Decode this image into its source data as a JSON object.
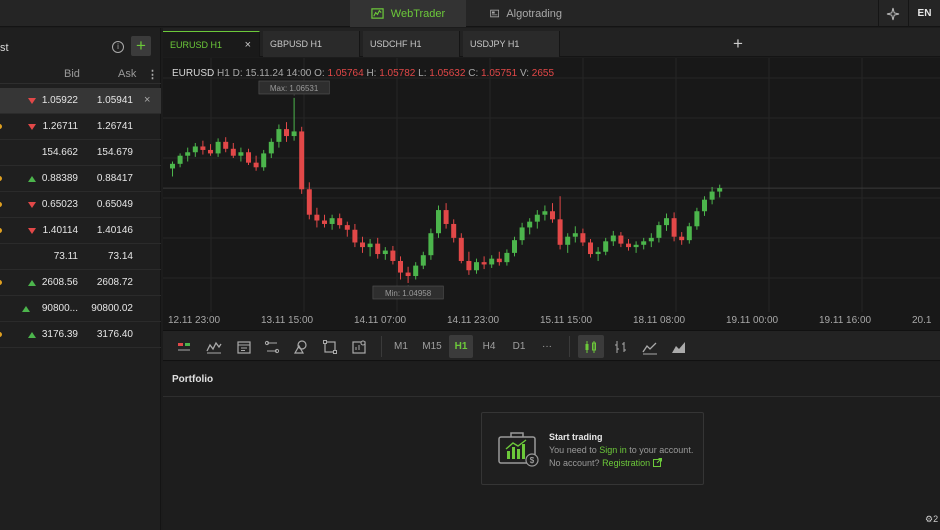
{
  "topbar": {
    "webtrader_label": "WebTrader",
    "algotrading_label": "Algotrading",
    "language": "EN",
    "accent": "#6cc93a"
  },
  "watchlist": {
    "title": "st",
    "bid_header": "Bid",
    "ask_header": "Ask",
    "rows": [
      {
        "bid": "1.05922",
        "ask": "1.05941",
        "dir": "down",
        "selected": true,
        "marker": false
      },
      {
        "bid": "1.26711",
        "ask": "1.26741",
        "dir": "down",
        "selected": false,
        "marker": true
      },
      {
        "bid": "154.662",
        "ask": "154.679",
        "dir": "none",
        "selected": false,
        "marker": false
      },
      {
        "bid": "0.88389",
        "ask": "0.88417",
        "dir": "up",
        "selected": false,
        "marker": true
      },
      {
        "bid": "0.65023",
        "ask": "0.65049",
        "dir": "down",
        "selected": false,
        "marker": true
      },
      {
        "bid": "1.40114",
        "ask": "1.40146",
        "dir": "down",
        "selected": false,
        "marker": true
      },
      {
        "bid": "73.11",
        "ask": "73.14",
        "dir": "none",
        "selected": false,
        "marker": false
      },
      {
        "bid": "2608.56",
        "ask": "2608.72",
        "dir": "up",
        "selected": false,
        "marker": true
      },
      {
        "bid": "90800...",
        "ask": "90800.02",
        "dir": "up",
        "selected": false,
        "marker": false
      },
      {
        "bid": "3176.39",
        "ask": "3176.40",
        "dir": "up",
        "selected": false,
        "marker": true
      }
    ]
  },
  "tabs": [
    {
      "label": "EURUSD H1",
      "active": true,
      "closable": true
    },
    {
      "label": "GBPUSD H1",
      "active": false,
      "closable": false
    },
    {
      "label": "USDCHF H1",
      "active": false,
      "closable": false
    },
    {
      "label": "USDJPY H1",
      "active": false,
      "closable": false
    }
  ],
  "chart_info": {
    "symbol": "EURUSD",
    "timeframe": "H1",
    "d_label": "D:",
    "d_value": "15.11.24 14:00",
    "o_label": "O:",
    "o_value": "1.05764",
    "h_label": "H:",
    "h_value": "1.05782",
    "l_label": "L:",
    "l_value": "1.05632",
    "c_label": "C:",
    "c_value": "1.05751",
    "v_label": "V:",
    "v_value": "2655",
    "max_label": "Max: 1.06531",
    "min_label": "Min: 1.04958",
    "up_color": "#4cb54c",
    "down_color": "#e24848"
  },
  "chart_data": {
    "type": "candlestick",
    "x_ticks": [
      "12.11 23:00",
      "13.11 15:00",
      "14.11 07:00",
      "14.11 23:00",
      "15.11 15:00",
      "18.11 08:00",
      "19.11 00:00",
      "19.11 16:00",
      "20.1"
    ],
    "max": 1.06531,
    "min": 1.04958,
    "grid": true,
    "candles": [
      {
        "o": 1.0592,
        "h": 1.0598,
        "l": 1.0585,
        "c": 1.0596
      },
      {
        "o": 1.0596,
        "h": 1.0605,
        "l": 1.0593,
        "c": 1.0603
      },
      {
        "o": 1.0603,
        "h": 1.061,
        "l": 1.0598,
        "c": 1.0606
      },
      {
        "o": 1.0606,
        "h": 1.0614,
        "l": 1.0602,
        "c": 1.0611
      },
      {
        "o": 1.0611,
        "h": 1.0616,
        "l": 1.0604,
        "c": 1.0608
      },
      {
        "o": 1.0608,
        "h": 1.0613,
        "l": 1.0603,
        "c": 1.0605
      },
      {
        "o": 1.0605,
        "h": 1.0618,
        "l": 1.0602,
        "c": 1.0615
      },
      {
        "o": 1.0615,
        "h": 1.0619,
        "l": 1.0606,
        "c": 1.0609
      },
      {
        "o": 1.0609,
        "h": 1.0614,
        "l": 1.0601,
        "c": 1.0603
      },
      {
        "o": 1.0603,
        "h": 1.061,
        "l": 1.0598,
        "c": 1.0606
      },
      {
        "o": 1.0606,
        "h": 1.0609,
        "l": 1.0595,
        "c": 1.0597
      },
      {
        "o": 1.0597,
        "h": 1.0603,
        "l": 1.059,
        "c": 1.0593
      },
      {
        "o": 1.0593,
        "h": 1.0608,
        "l": 1.059,
        "c": 1.0605
      },
      {
        "o": 1.0605,
        "h": 1.0618,
        "l": 1.0601,
        "c": 1.0615
      },
      {
        "o": 1.0615,
        "h": 1.063,
        "l": 1.061,
        "c": 1.0626
      },
      {
        "o": 1.0626,
        "h": 1.0632,
        "l": 1.0615,
        "c": 1.062
      },
      {
        "o": 1.062,
        "h": 1.0653,
        "l": 1.0616,
        "c": 1.0624
      },
      {
        "o": 1.0624,
        "h": 1.0628,
        "l": 1.057,
        "c": 1.0574
      },
      {
        "o": 1.0574,
        "h": 1.058,
        "l": 1.0548,
        "c": 1.0552
      },
      {
        "o": 1.0552,
        "h": 1.0558,
        "l": 1.0541,
        "c": 1.0547
      },
      {
        "o": 1.0547,
        "h": 1.0552,
        "l": 1.0541,
        "c": 1.0544
      },
      {
        "o": 1.0544,
        "h": 1.0552,
        "l": 1.0539,
        "c": 1.0549
      },
      {
        "o": 1.0549,
        "h": 1.0553,
        "l": 1.054,
        "c": 1.0543
      },
      {
        "o": 1.0543,
        "h": 1.0546,
        "l": 1.0533,
        "c": 1.0539
      },
      {
        "o": 1.0539,
        "h": 1.0544,
        "l": 1.0524,
        "c": 1.0528
      },
      {
        "o": 1.0528,
        "h": 1.0533,
        "l": 1.0519,
        "c": 1.0524
      },
      {
        "o": 1.0524,
        "h": 1.0531,
        "l": 1.0516,
        "c": 1.0527
      },
      {
        "o": 1.0527,
        "h": 1.0532,
        "l": 1.0514,
        "c": 1.0518
      },
      {
        "o": 1.0518,
        "h": 1.0524,
        "l": 1.0513,
        "c": 1.0521
      },
      {
        "o": 1.0521,
        "h": 1.0525,
        "l": 1.0509,
        "c": 1.0512
      },
      {
        "o": 1.0512,
        "h": 1.0516,
        "l": 1.0496,
        "c": 1.0502
      },
      {
        "o": 1.0502,
        "h": 1.0507,
        "l": 1.0493,
        "c": 1.0499
      },
      {
        "o": 1.0499,
        "h": 1.0511,
        "l": 1.0496,
        "c": 1.0508
      },
      {
        "o": 1.0508,
        "h": 1.052,
        "l": 1.0505,
        "c": 1.0517
      },
      {
        "o": 1.0517,
        "h": 1.054,
        "l": 1.0513,
        "c": 1.0536
      },
      {
        "o": 1.0536,
        "h": 1.056,
        "l": 1.0532,
        "c": 1.0556
      },
      {
        "o": 1.0556,
        "h": 1.0562,
        "l": 1.054,
        "c": 1.0544
      },
      {
        "o": 1.0544,
        "h": 1.0548,
        "l": 1.0528,
        "c": 1.0532
      },
      {
        "o": 1.0532,
        "h": 1.0536,
        "l": 1.051,
        "c": 1.0512
      },
      {
        "o": 1.0512,
        "h": 1.052,
        "l": 1.05,
        "c": 1.0504
      },
      {
        "o": 1.0504,
        "h": 1.0514,
        "l": 1.0501,
        "c": 1.0511
      },
      {
        "o": 1.0511,
        "h": 1.0516,
        "l": 1.0505,
        "c": 1.0509
      },
      {
        "o": 1.0509,
        "h": 1.0517,
        "l": 1.0506,
        "c": 1.0514
      },
      {
        "o": 1.0514,
        "h": 1.052,
        "l": 1.0508,
        "c": 1.0511
      },
      {
        "o": 1.0511,
        "h": 1.0522,
        "l": 1.0508,
        "c": 1.0519
      },
      {
        "o": 1.0519,
        "h": 1.0533,
        "l": 1.0516,
        "c": 1.053
      },
      {
        "o": 1.053,
        "h": 1.0545,
        "l": 1.0526,
        "c": 1.0541
      },
      {
        "o": 1.0541,
        "h": 1.0549,
        "l": 1.0535,
        "c": 1.0546
      },
      {
        "o": 1.0546,
        "h": 1.0556,
        "l": 1.054,
        "c": 1.0552
      },
      {
        "o": 1.0552,
        "h": 1.056,
        "l": 1.0547,
        "c": 1.0555
      },
      {
        "o": 1.0555,
        "h": 1.0562,
        "l": 1.0545,
        "c": 1.0548
      },
      {
        "o": 1.0548,
        "h": 1.0568,
        "l": 1.0522,
        "c": 1.0526
      },
      {
        "o": 1.0526,
        "h": 1.0536,
        "l": 1.0519,
        "c": 1.0533
      },
      {
        "o": 1.0533,
        "h": 1.0542,
        "l": 1.0528,
        "c": 1.0536
      },
      {
        "o": 1.0536,
        "h": 1.054,
        "l": 1.0525,
        "c": 1.0528
      },
      {
        "o": 1.0528,
        "h": 1.0531,
        "l": 1.0515,
        "c": 1.0518
      },
      {
        "o": 1.0518,
        "h": 1.0524,
        "l": 1.0512,
        "c": 1.052
      },
      {
        "o": 1.052,
        "h": 1.0532,
        "l": 1.0517,
        "c": 1.0529
      },
      {
        "o": 1.0529,
        "h": 1.0538,
        "l": 1.0525,
        "c": 1.0534
      },
      {
        "o": 1.0534,
        "h": 1.0537,
        "l": 1.0524,
        "c": 1.0527
      },
      {
        "o": 1.0527,
        "h": 1.0531,
        "l": 1.0521,
        "c": 1.0524
      },
      {
        "o": 1.0524,
        "h": 1.0529,
        "l": 1.0519,
        "c": 1.0526
      },
      {
        "o": 1.0526,
        "h": 1.0532,
        "l": 1.0522,
        "c": 1.0529
      },
      {
        "o": 1.0529,
        "h": 1.0536,
        "l": 1.0524,
        "c": 1.0532
      },
      {
        "o": 1.0532,
        "h": 1.0546,
        "l": 1.0528,
        "c": 1.0543
      },
      {
        "o": 1.0543,
        "h": 1.0553,
        "l": 1.0538,
        "c": 1.0549
      },
      {
        "o": 1.0549,
        "h": 1.0554,
        "l": 1.0529,
        "c": 1.0533
      },
      {
        "o": 1.0533,
        "h": 1.0537,
        "l": 1.0526,
        "c": 1.053
      },
      {
        "o": 1.053,
        "h": 1.0545,
        "l": 1.0527,
        "c": 1.0542
      },
      {
        "o": 1.0542,
        "h": 1.0558,
        "l": 1.0539,
        "c": 1.0555
      },
      {
        "o": 1.0555,
        "h": 1.0568,
        "l": 1.0551,
        "c": 1.0565
      },
      {
        "o": 1.0565,
        "h": 1.0576,
        "l": 1.0561,
        "c": 1.0572
      },
      {
        "o": 1.0572,
        "h": 1.0578,
        "l": 1.0567,
        "c": 1.0575
      }
    ]
  },
  "toolbar": {
    "timeframes": [
      "M1",
      "M15",
      "H1",
      "H4",
      "D1"
    ],
    "active_timeframe": "H1",
    "more": "···"
  },
  "portfolio": {
    "title": "Portfolio",
    "start_title": "Start trading",
    "line1_pre": "You need to",
    "line1_link": "Sign in",
    "line1_post": "to your account.",
    "line2_pre": "No account?",
    "line2_link": "Registration",
    "corner": "2"
  }
}
